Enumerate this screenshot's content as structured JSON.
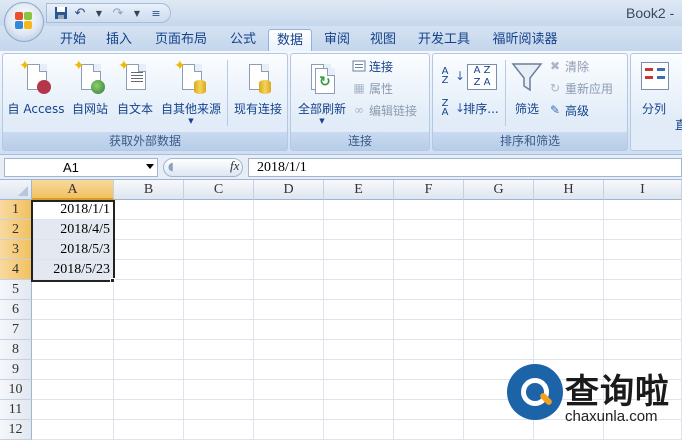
{
  "titlebar": {
    "doc_title": "Book2 -",
    "qat": {
      "save_icon": "save-icon",
      "undo_icon": "undo-icon",
      "redo_icon": "redo-icon",
      "customize_icon": "customize-qat-icon"
    }
  },
  "tabs": [
    {
      "label": "开始"
    },
    {
      "label": "插入"
    },
    {
      "label": "页面布局"
    },
    {
      "label": "公式"
    },
    {
      "label": "数据",
      "active": true
    },
    {
      "label": "审阅"
    },
    {
      "label": "视图"
    },
    {
      "label": "开发工具"
    },
    {
      "label": "福昕阅读器"
    }
  ],
  "ribbon": {
    "external_data": {
      "label": "获取外部数据",
      "buttons": [
        {
          "label": "自 Access",
          "icon": "access-icon"
        },
        {
          "label": "自网站",
          "icon": "web-icon"
        },
        {
          "label": "自文本",
          "icon": "text-file-icon"
        },
        {
          "label": "自其他来源",
          "icon": "other-sources-icon"
        }
      ],
      "existing": {
        "label": "现有连接",
        "icon": "existing-connections-icon"
      }
    },
    "connections": {
      "label": "连接",
      "refresh_all": {
        "label": "全部刷新",
        "icon": "refresh-icon"
      },
      "small": [
        {
          "label": "连接",
          "icon": "connections-icon",
          "enabled": true
        },
        {
          "label": "属性",
          "icon": "properties-icon",
          "enabled": false
        },
        {
          "label": "编辑链接",
          "icon": "edit-links-icon",
          "enabled": false
        }
      ]
    },
    "sort_filter": {
      "label": "排序和筛选",
      "sort_az_icon": "sort-ascending-icon",
      "sort_za_icon": "sort-descending-icon",
      "sort": {
        "label": "排序...",
        "icon": "sort-icon"
      },
      "filter": {
        "label": "筛选",
        "icon": "filter-icon"
      },
      "small": [
        {
          "label": "清除",
          "icon": "clear-filter-icon",
          "enabled": false
        },
        {
          "label": "重新应用",
          "icon": "reapply-icon",
          "enabled": false
        },
        {
          "label": "高级",
          "icon": "advanced-filter-icon",
          "enabled": true
        }
      ]
    },
    "data_tools": {
      "split": {
        "label": "分列",
        "icon": "text-to-columns-icon"
      },
      "partial_label": "直"
    }
  },
  "formula_bar": {
    "name_box": "A1",
    "fx_label": "fx",
    "formula": "2018/1/1"
  },
  "sheet": {
    "columns": [
      "A",
      "B",
      "C",
      "D",
      "E",
      "F",
      "G",
      "H",
      "I"
    ],
    "selected_column": "A",
    "rows": [
      "1",
      "2",
      "3",
      "4",
      "5",
      "6",
      "7",
      "8",
      "9",
      "10",
      "11",
      "12"
    ],
    "selected_rows": [
      "1",
      "2",
      "3",
      "4"
    ],
    "column_a_values": [
      "2018/1/1",
      "2018/4/5",
      "2018/5/3",
      "2018/5/23"
    ]
  },
  "watermark": {
    "text": "查询啦",
    "url": "chaxunla.com"
  },
  "colors": {
    "ribbon_text": "#15428b",
    "selection_header": "#f1c15f",
    "watermark_blue": "#1d63a8"
  }
}
